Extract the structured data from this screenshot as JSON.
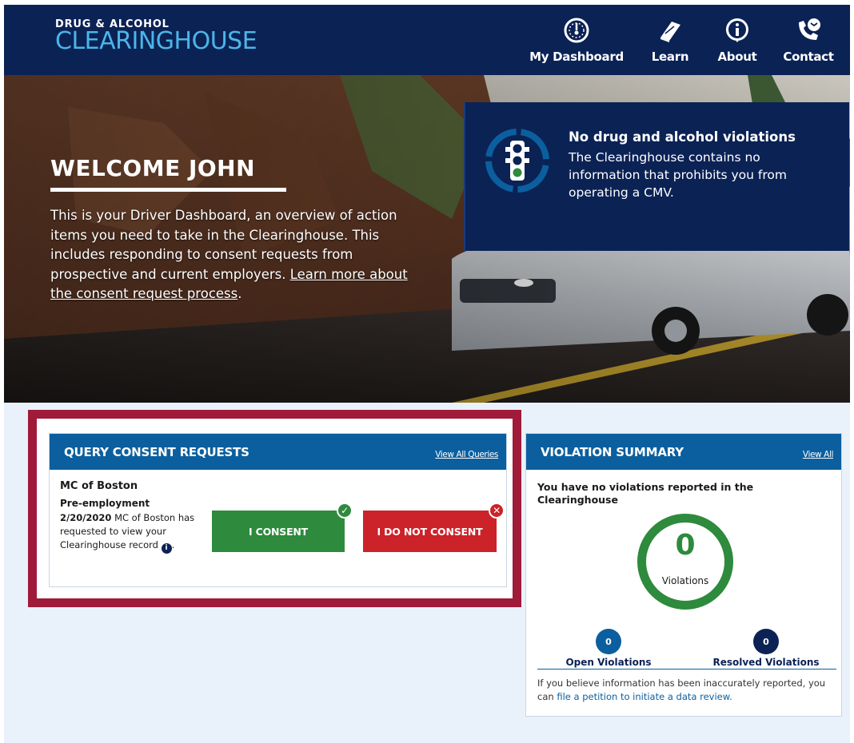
{
  "header": {
    "logo_top": "DRUG & ALCOHOL",
    "logo_bottom": "CLEARINGHOUSE",
    "nav": [
      {
        "label": "My Dashboard",
        "icon": "dashboard-gauge-icon"
      },
      {
        "label": "Learn",
        "icon": "book-icon"
      },
      {
        "label": "About",
        "icon": "info-icon"
      },
      {
        "label": "Contact",
        "icon": "phone-chat-icon"
      }
    ]
  },
  "hero": {
    "title": "WELCOME JOHN",
    "intro": "This is your Driver Dashboard, an overview of action items you need to take in the Clearinghouse. This includes responding to consent requests from prospective and current employers.",
    "intro_link": "Learn more about the consent request process",
    "intro_end": ".",
    "status": {
      "title": "No drug and alcohol violations",
      "description": "The Clearinghouse contains no information that prohibits you from operating a CMV.",
      "icon": "traffic-light-icon"
    }
  },
  "consent": {
    "title": "QUERY CONSENT REQUESTS",
    "view_all": "View All Queries",
    "request": {
      "company": "MC of Boston",
      "type": "Pre-employment",
      "date": "2/20/2020",
      "description": "MC of Boston has requested to view your Clearinghouse record"
    },
    "consent_label": "I CONSENT",
    "decline_label": "I DO NOT CONSENT"
  },
  "violations": {
    "title": "VIOLATION SUMMARY",
    "view_all": "View All",
    "message": "You have no violations reported in the Clearinghouse",
    "count": "0",
    "count_label": "Violations",
    "open_count": "0",
    "open_label": "Open Violations",
    "resolved_count": "0",
    "resolved_label": "Resolved Violations",
    "footer_text": "If you believe information has been inaccurately reported, you can",
    "footer_link": "file a petition to initiate a data review."
  },
  "colors": {
    "navy": "#0b2255",
    "blue": "#0b5f9e",
    "green": "#2e8a3c",
    "red": "#cc2229",
    "highlight": "#a01a3a"
  }
}
